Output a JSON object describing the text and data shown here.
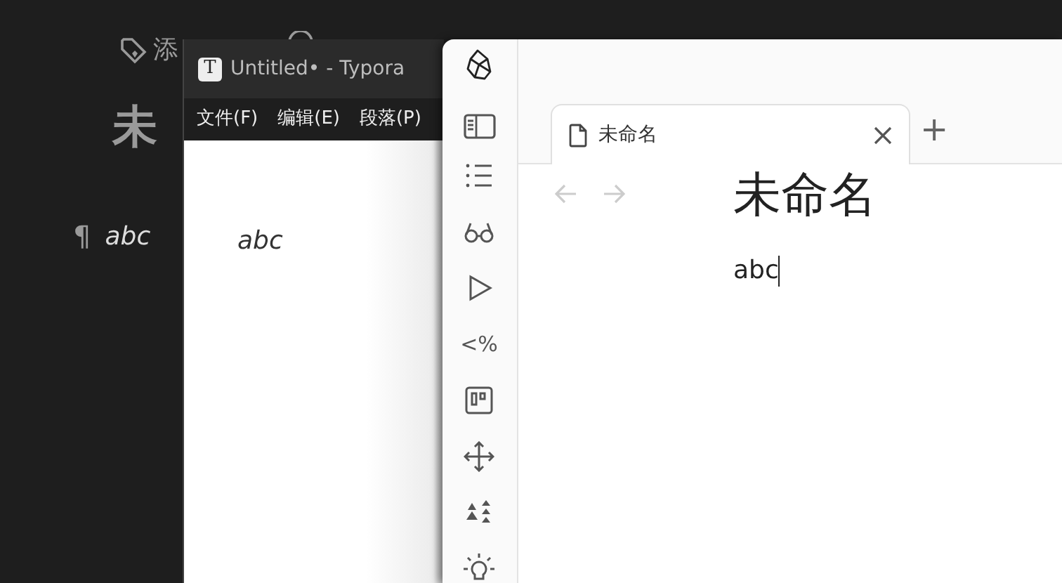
{
  "background_editor": {
    "tag_action": "添",
    "title": "未",
    "paragraph_mark": "¶",
    "paragraph": "abc"
  },
  "typora": {
    "title": "Untitled• - Typora",
    "logo": "T",
    "menu": [
      "文件(F)",
      "编辑(E)",
      "段落(P)"
    ],
    "body": "abc"
  },
  "obsidian": {
    "tabs": [
      {
        "label": "未命名",
        "selected": true
      }
    ],
    "new_tab": "+",
    "ribbon": [
      {
        "kind": "list"
      },
      {
        "kind": "glasses"
      },
      {
        "kind": "play"
      },
      {
        "kind": "text",
        "label": "<%"
      },
      {
        "kind": "kanban"
      },
      {
        "kind": "move"
      },
      {
        "kind": "sort"
      },
      {
        "kind": "bulb"
      }
    ],
    "note": {
      "title": "未命名",
      "body": "abc"
    }
  }
}
